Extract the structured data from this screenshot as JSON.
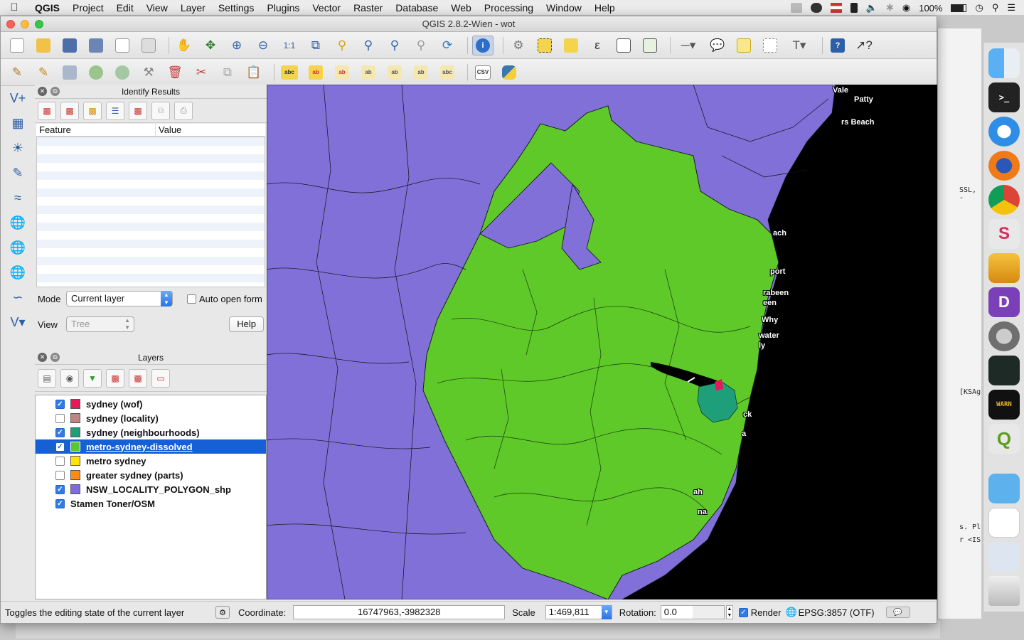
{
  "menubar": {
    "app": "QGIS",
    "items": [
      "Project",
      "Edit",
      "View",
      "Layer",
      "Settings",
      "Plugins",
      "Vector",
      "Raster",
      "Database",
      "Web",
      "Processing",
      "Window",
      "Help"
    ],
    "battery": "100%"
  },
  "window": {
    "title": "QGIS 2.8.2-Wien - wot"
  },
  "identify": {
    "title": "Identify Results",
    "col_feature": "Feature",
    "col_value": "Value",
    "mode_label": "Mode",
    "mode_value": "Current layer",
    "auto_open_label": "Auto open form",
    "view_label": "View",
    "view_value": "Tree",
    "help_label": "Help"
  },
  "layers_panel": {
    "title": "Layers",
    "items": [
      {
        "name": "sydney (wof)",
        "checked": true,
        "color": "#e8185a"
      },
      {
        "name": "sydney (locality)",
        "checked": false,
        "color": "#c08484"
      },
      {
        "name": "sydney (neighbourhoods)",
        "checked": true,
        "color": "#1e9f7a"
      },
      {
        "name": "metro-sydney-dissolved",
        "checked": true,
        "color": "#5ac828",
        "selected": true
      },
      {
        "name": "metro sydney",
        "checked": false,
        "color": "#ffe400"
      },
      {
        "name": "greater sydney (parts)",
        "checked": false,
        "color": "#ff8a14"
      },
      {
        "name": "NSW_LOCALITY_POLYGON_shp",
        "checked": true,
        "color": "#7f6bdc"
      },
      {
        "name": "Stamen Toner/OSM",
        "checked": true
      }
    ]
  },
  "map": {
    "labels": [
      "Vale",
      "Patty",
      "rs Beach",
      "ach",
      "port",
      "rabeen",
      "een",
      "Why",
      "water",
      "ly",
      "ck",
      "a",
      "ah",
      "na"
    ],
    "colors": {
      "locality": "#8070d8",
      "metro": "#5ec928",
      "sea": "#000000",
      "wof": "#e8185a",
      "neighbourhoods": "#1e9f7a"
    }
  },
  "status": {
    "message": "Toggles the editing state of the current layer",
    "coordinate_label": "Coordinate:",
    "coordinate_value": "16747963,-3982328",
    "scale_label": "Scale",
    "scale_value": "1:469,811",
    "rotation_label": "Rotation:",
    "rotation_value": "0.0",
    "render_label": "Render",
    "crs": "EPSG:3857 (OTF)"
  },
  "background_terminal": {
    "lines": [
      "SSL, -",
      "[KSAg",
      "s. Pl",
      "r <IS"
    ]
  }
}
